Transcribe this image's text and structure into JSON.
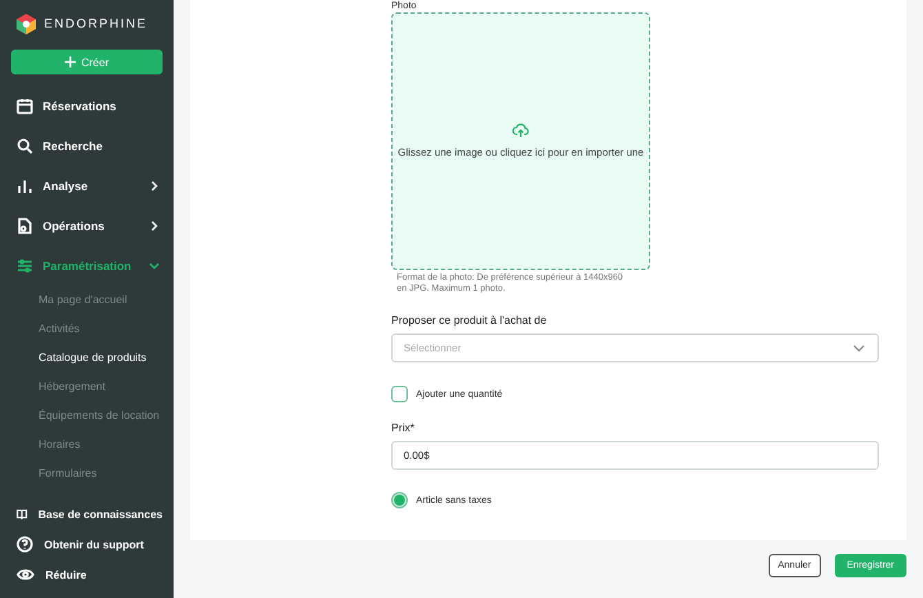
{
  "sidebar": {
    "brand": "ENDORPHINE",
    "create_button": "Créer",
    "items": [
      {
        "label": "Réservations",
        "selected": false
      },
      {
        "label": "Recherche",
        "selected": false
      },
      {
        "label": "Analyse",
        "expanded": false,
        "selected": false
      },
      {
        "label": "Opérations",
        "expanded": false,
        "selected": false
      },
      {
        "label": "Paramétrisation",
        "expanded": true,
        "selected": true,
        "children": [
          {
            "label": "Ma page d'accueil",
            "selected": false
          },
          {
            "label": "Activités",
            "selected": false
          },
          {
            "label": "Catalogue de produits",
            "selected": true
          },
          {
            "label": "Hébergement",
            "selected": false
          },
          {
            "label": "Équipements de location",
            "selected": false
          },
          {
            "label": "Horaires",
            "selected": false
          },
          {
            "label": "Formulaires",
            "selected": false
          }
        ]
      }
    ],
    "footer": [
      {
        "label": "Base de connaissances"
      },
      {
        "label": "Obtenir du support"
      },
      {
        "label": "Réduire"
      }
    ]
  },
  "form": {
    "photo": {
      "label": "Photo",
      "drop_text": "Glissez une image ou cliquez ici pour en importer une",
      "hint": "Format de la photo: De préférence supérieur à 1440x960 en JPG. Maximum 1 photo."
    },
    "offer": {
      "label": "Proposer ce produit à l'achat de",
      "placeholder": "Sélectionner"
    },
    "quantity": {
      "kind": "checkbox",
      "label": "Ajouter une quantité",
      "checked": false
    },
    "price": {
      "label": "Prix*",
      "value": "0.00$"
    },
    "tax_free": {
      "kind": "radio",
      "label": "Article sans taxes",
      "checked": true
    }
  },
  "buttons": [
    {
      "label": "Annuler",
      "kind": "secondary"
    },
    {
      "label": "Enregistrer",
      "kind": "primary"
    }
  ]
}
